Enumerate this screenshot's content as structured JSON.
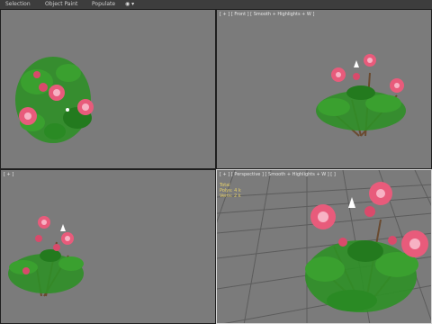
{
  "ribbon": {
    "tabs": [
      "Selection",
      "Object Paint",
      "Populate"
    ],
    "pin_glyph": "◉ ▾"
  },
  "viewports": [
    {
      "label": "",
      "active": false
    },
    {
      "label": "[ + ] [ Front ] [ Smooth + Highlights + W ]",
      "active": false
    },
    {
      "label": "[ + ]",
      "active": false
    },
    {
      "label": "[ + ] [ Perspective ] [ Smooth + Highlights + W ] [ ]",
      "active": true
    }
  ],
  "stats": {
    "rows": [
      "Total",
      "Polys: 4 k",
      "Verts: 2 k"
    ]
  },
  "colors": {
    "viewport_bg": "#7b7b7b",
    "leaf": "#2f8f27",
    "leaf_dark": "#1f6b1c",
    "rose": "#e85b7b",
    "rose_light": "#f7b2c4",
    "stem": "#6a4a2f",
    "grid": "#555555"
  }
}
